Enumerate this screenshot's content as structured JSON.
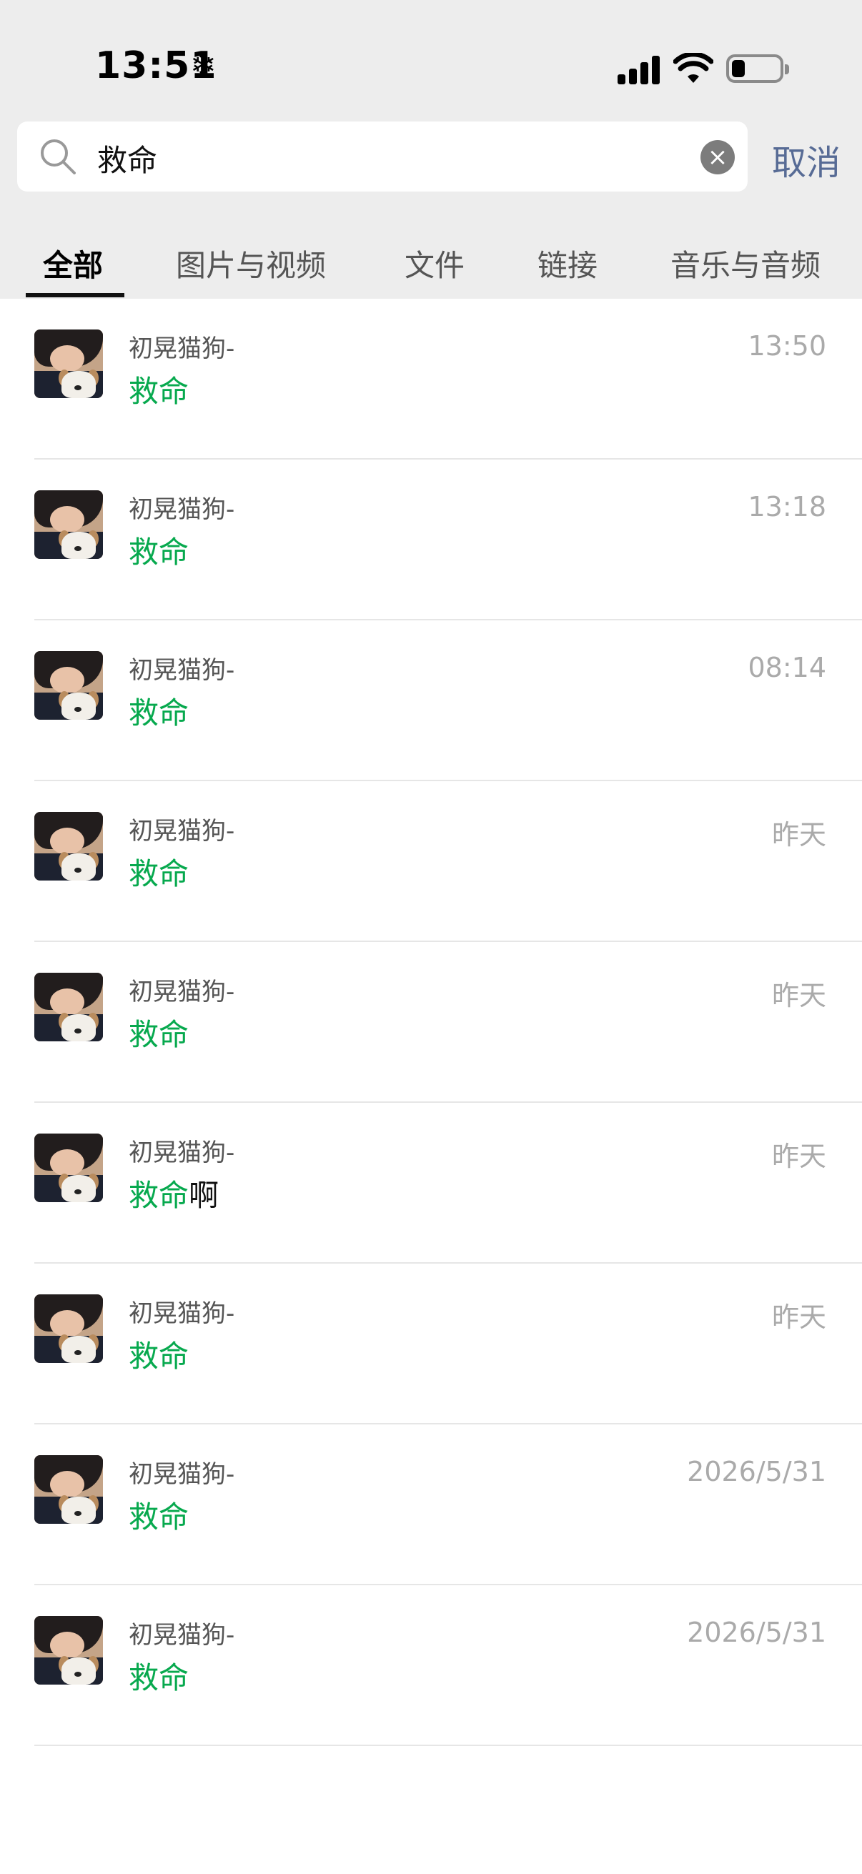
{
  "status_bar": {
    "time": "13:51",
    "extra_icon": "❄"
  },
  "search": {
    "query": "救命",
    "cancel_label": "取消"
  },
  "tabs": [
    {
      "label": "全部",
      "active": true
    },
    {
      "label": "图片与视频",
      "active": false
    },
    {
      "label": "文件",
      "active": false
    },
    {
      "label": "链接",
      "active": false
    },
    {
      "label": "音乐与音频",
      "active": false
    }
  ],
  "results": [
    {
      "name": "初晃猫狗-",
      "highlight": "救命",
      "rest": "",
      "time": "13:50"
    },
    {
      "name": "初晃猫狗-",
      "highlight": "救命",
      "rest": "",
      "time": "13:18"
    },
    {
      "name": "初晃猫狗-",
      "highlight": "救命",
      "rest": "",
      "time": "08:14"
    },
    {
      "name": "初晃猫狗-",
      "highlight": "救命",
      "rest": "",
      "time": "昨天"
    },
    {
      "name": "初晃猫狗-",
      "highlight": "救命",
      "rest": "",
      "time": "昨天"
    },
    {
      "name": "初晃猫狗-",
      "highlight": "救命",
      "rest": "啊",
      "time": "昨天"
    },
    {
      "name": "初晃猫狗-",
      "highlight": "救命",
      "rest": "",
      "time": "昨天"
    },
    {
      "name": "初晃猫狗-",
      "highlight": "救命",
      "rest": "",
      "time": "2026/5/31"
    },
    {
      "name": "初晃猫狗-",
      "highlight": "救命",
      "rest": "",
      "time": "2026/5/31"
    }
  ],
  "colors": {
    "highlight": "#07a94e",
    "link": "#576b95",
    "header_bg": "#ededed"
  }
}
